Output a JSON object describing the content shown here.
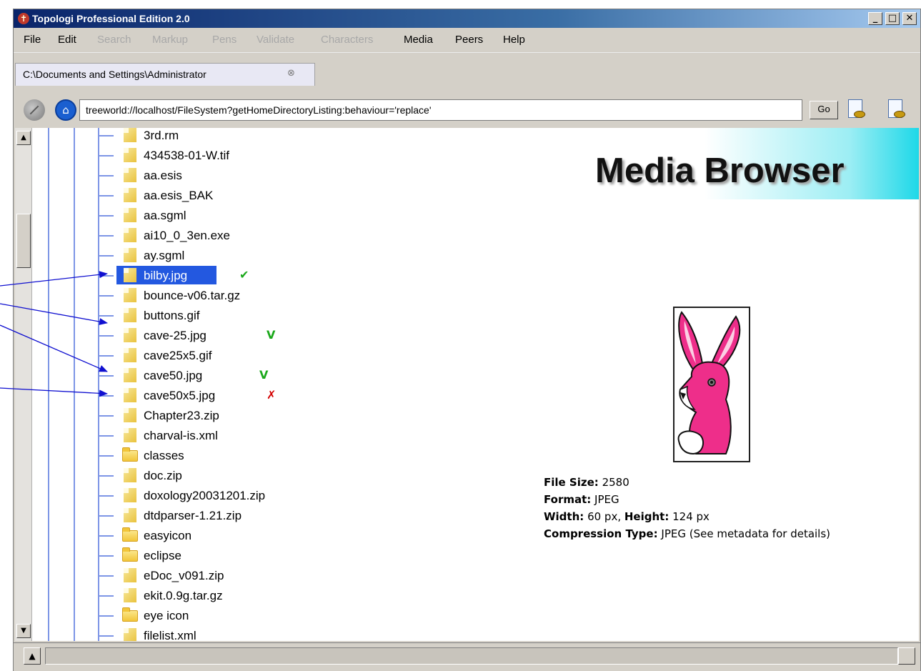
{
  "window": {
    "title": "Topologi Professional Edition 2.0",
    "app_icon_glyph": "✝",
    "controls": {
      "minimize": "_",
      "maximize": "□",
      "close": "✕"
    }
  },
  "menu": {
    "file": "File",
    "edit": "Edit",
    "search": "Search",
    "markup": "Markup",
    "pens": "Pens",
    "validate": "Validate",
    "characters": "Characters",
    "media": "Media",
    "peers": "Peers",
    "help": "Help"
  },
  "tab": {
    "label": "C:\\Documents and Settings\\Administrator",
    "close_glyph": "⊗"
  },
  "address": {
    "url": "treeworld://localhost/FileSystem?getHomeDirectoryListing:behaviour='replace'",
    "go_label": "Go",
    "home_glyph": "⌂"
  },
  "scroll": {
    "up": "▲",
    "down": "▼"
  },
  "tree": {
    "items": [
      {
        "name": "3rd.rm",
        "type": "file"
      },
      {
        "name": "434538-01-W.tif",
        "type": "file"
      },
      {
        "name": "aa.esis",
        "type": "file"
      },
      {
        "name": "aa.esis_BAK",
        "type": "file"
      },
      {
        "name": "aa.sgml",
        "type": "file"
      },
      {
        "name": "ai10_0_3en.exe",
        "type": "file"
      },
      {
        "name": "ay.sgml",
        "type": "file"
      },
      {
        "name": "bilby.jpg",
        "type": "file",
        "selected": true,
        "mark": "✔"
      },
      {
        "name": "bounce-v06.tar.gz",
        "type": "file"
      },
      {
        "name": "buttons.gif",
        "type": "file"
      },
      {
        "name": "cave-25.jpg",
        "type": "file",
        "mark": "V"
      },
      {
        "name": "cave25x5.gif",
        "type": "file"
      },
      {
        "name": "cave50.jpg",
        "type": "file",
        "mark": "V"
      },
      {
        "name": "cave50x5.jpg",
        "type": "file",
        "mark": "✗"
      },
      {
        "name": "Chapter23.zip",
        "type": "file"
      },
      {
        "name": "charval-is.xml",
        "type": "file"
      },
      {
        "name": "classes",
        "type": "folder"
      },
      {
        "name": "doc.zip",
        "type": "file"
      },
      {
        "name": "doxology20031201.zip",
        "type": "file"
      },
      {
        "name": "dtdparser-1.21.zip",
        "type": "file"
      },
      {
        "name": "easyicon",
        "type": "folder"
      },
      {
        "name": "eclipse",
        "type": "folder"
      },
      {
        "name": "eDoc_v091.zip",
        "type": "file"
      },
      {
        "name": "ekit.0.9g.tar.gz",
        "type": "file"
      },
      {
        "name": "eye icon",
        "type": "folder"
      },
      {
        "name": "filelist.xml",
        "type": "file"
      }
    ]
  },
  "media_browser": {
    "title": "Media Browser",
    "file_size_label": "File Size:",
    "file_size_value": "2580",
    "format_label": "Format:",
    "format_value": "JPEG",
    "width_label": "Width:",
    "width_value": "60 px,",
    "height_label": "Height:",
    "height_value": "124 px",
    "compression_label": "Compression Type:",
    "compression_value": "JPEG (See metadata for details)"
  },
  "status": {
    "up_glyph": "▲"
  },
  "colors": {
    "title_gradient_start": "#0a246a",
    "selection": "#2358e0",
    "tree_line": "#7d95e6",
    "annotation_arrow": "#1010d0",
    "bunny": "#ee2e8a",
    "ok_mark": "#1aa81a",
    "bad_mark": "#d40000"
  }
}
